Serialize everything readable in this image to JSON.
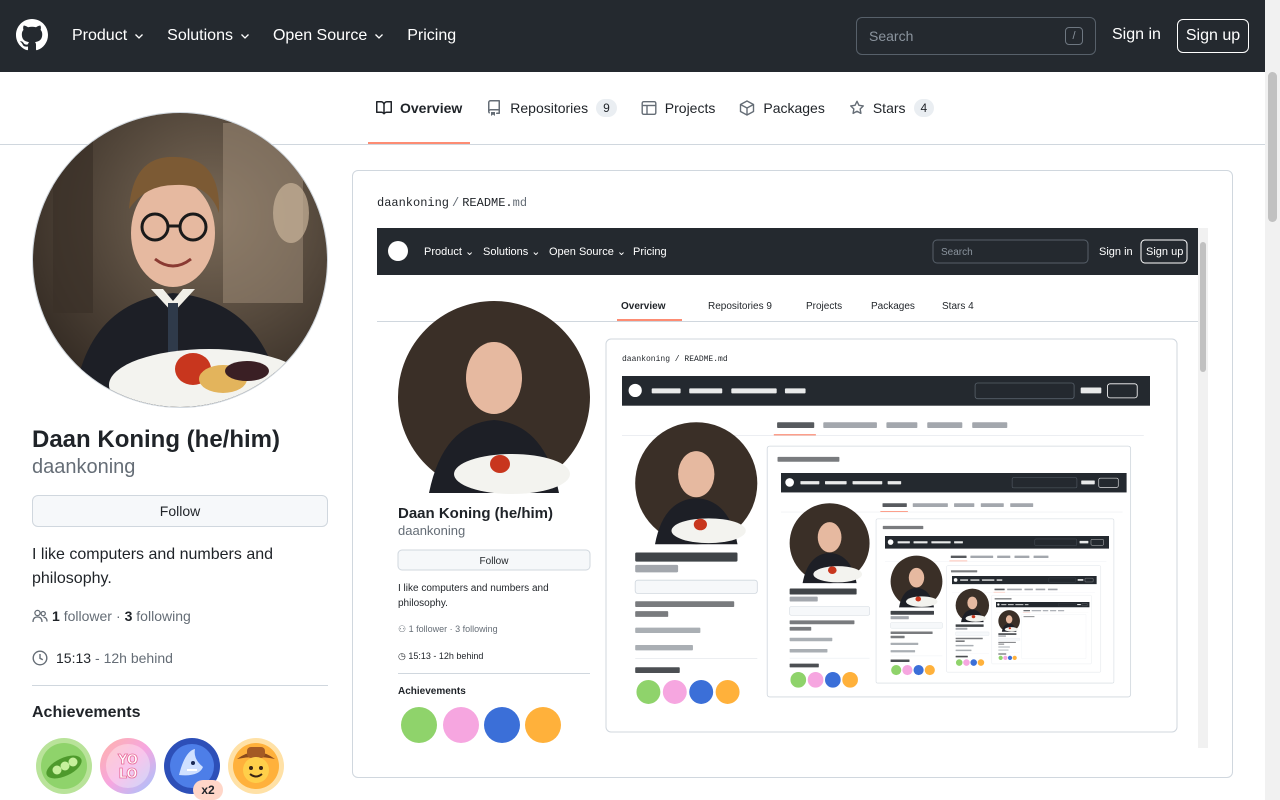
{
  "header": {
    "nav": [
      {
        "label": "Product",
        "has_caret": true
      },
      {
        "label": "Solutions",
        "has_caret": true
      },
      {
        "label": "Open Source",
        "has_caret": true
      },
      {
        "label": "Pricing",
        "has_caret": false
      }
    ],
    "search_placeholder": "Search",
    "search_shortcut": "/",
    "signin_label": "Sign in",
    "signup_label": "Sign up",
    "logo_icon": "github-mark-icon"
  },
  "tabs": [
    {
      "label": "Overview",
      "icon": "book-icon",
      "active": true,
      "count": ""
    },
    {
      "label": "Repositories",
      "icon": "repo-icon",
      "active": false,
      "count": "9"
    },
    {
      "label": "Projects",
      "icon": "table-icon",
      "active": false,
      "count": ""
    },
    {
      "label": "Packages",
      "icon": "package-icon",
      "active": false,
      "count": ""
    },
    {
      "label": "Stars",
      "icon": "star-icon",
      "active": false,
      "count": "4"
    }
  ],
  "profile": {
    "name": "Daan Koning (he/him)",
    "login": "daankoning",
    "follow_label": "Follow",
    "bio": "I like computers and numbers and philosophy.",
    "followers_count": "1",
    "followers_label": "follower",
    "following_count": "3",
    "following_label": "following",
    "separator": "·",
    "local_time": "15:13",
    "time_behind": "- 12h behind",
    "achievements_title": "Achievements",
    "achievements": [
      {
        "name": "pair-extraordinaire",
        "icon": "peas-pod-icon",
        "color": "#7ac943"
      },
      {
        "name": "yolo",
        "icon": "yolo-icon",
        "color": "#f3a6c8"
      },
      {
        "name": "pull-shark",
        "icon": "shark-icon",
        "color": "#3b6fd8",
        "multiplier": "x2"
      },
      {
        "name": "quickdraw",
        "icon": "cowboy-icon",
        "color": "#f4a52e"
      }
    ]
  },
  "readme": {
    "owner": "daankoning",
    "sep": "/",
    "file_base": "README.",
    "file_ext": "md"
  },
  "colors": {
    "header_bg": "#24292f",
    "active_tab_underline": "#fd8c73",
    "border": "#d0d7de",
    "muted_text": "#656d76"
  }
}
